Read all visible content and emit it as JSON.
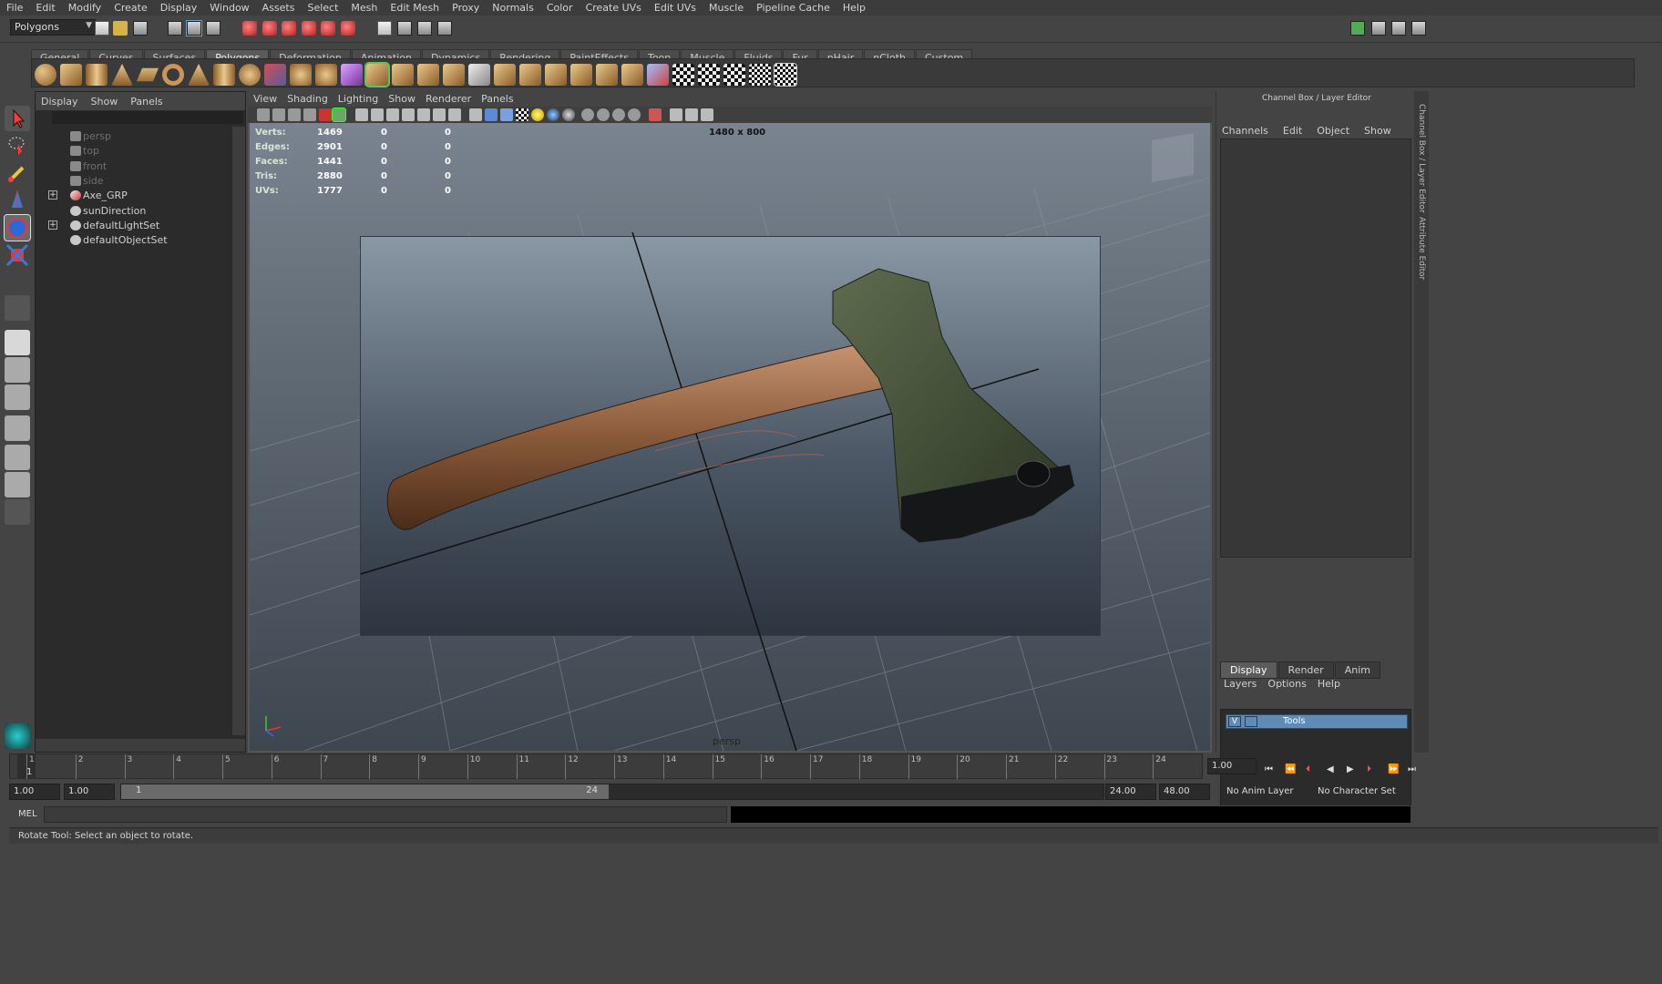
{
  "menubar": [
    "File",
    "Edit",
    "Modify",
    "Create",
    "Display",
    "Window",
    "Assets",
    "Select",
    "Mesh",
    "Edit Mesh",
    "Proxy",
    "Normals",
    "Color",
    "Create UVs",
    "Edit UVs",
    "Muscle",
    "Pipeline Cache",
    "Help"
  ],
  "status": {
    "mode": "Polygons"
  },
  "shelf_tabs": [
    "General",
    "Curves",
    "Surfaces",
    "Polygons",
    "Deformation",
    "Animation",
    "Dynamics",
    "Rendering",
    "PaintEffects",
    "Toon",
    "Muscle",
    "Fluids",
    "Fur",
    "nHair",
    "nCloth",
    "Custom"
  ],
  "shelf_active": "Polygons",
  "outliner": {
    "menu": [
      "Display",
      "Show",
      "Panels"
    ],
    "items": [
      {
        "label": "persp",
        "dim": true
      },
      {
        "label": "top",
        "dim": true
      },
      {
        "label": "front",
        "dim": true
      },
      {
        "label": "side",
        "dim": true
      },
      {
        "label": "Axe_GRP",
        "expand": "+"
      },
      {
        "label": "sunDirection"
      },
      {
        "label": "defaultLightSet",
        "expand": "+"
      },
      {
        "label": "defaultObjectSet"
      }
    ]
  },
  "viewport": {
    "menu": [
      "View",
      "Shading",
      "Lighting",
      "Show",
      "Renderer",
      "Panels"
    ],
    "hud": [
      {
        "label": "Verts:",
        "a": "1469",
        "b": "0",
        "c": "0"
      },
      {
        "label": "Edges:",
        "a": "2901",
        "b": "0",
        "c": "0"
      },
      {
        "label": "Faces:",
        "a": "1441",
        "b": "0",
        "c": "0"
      },
      {
        "label": "Tris:",
        "a": "2880",
        "b": "0",
        "c": "0"
      },
      {
        "label": "UVs:",
        "a": "1777",
        "b": "0",
        "c": "0"
      }
    ],
    "resolution": "1480 x 800",
    "camera": "persp"
  },
  "channel_box": {
    "title": "Channel Box / Layer Editor",
    "menu": [
      "Channels",
      "Edit",
      "Object",
      "Show"
    ],
    "tabs": [
      "Display",
      "Render",
      "Anim"
    ],
    "tab_active": "Display",
    "layer_menu": [
      "Layers",
      "Options",
      "Help"
    ],
    "layer": {
      "v": "V",
      "name": "Tools"
    }
  },
  "side_tabs": [
    "Channel Box / Layer Editor",
    "Attribute Editor"
  ],
  "timeline": {
    "ticks": [
      "1",
      "2",
      "3",
      "4",
      "5",
      "6",
      "7",
      "8",
      "9",
      "10",
      "11",
      "12",
      "13",
      "14",
      "15",
      "16",
      "17",
      "18",
      "19",
      "20",
      "21",
      "22",
      "23",
      "24"
    ],
    "current": "1",
    "current_field": "1.00"
  },
  "range": {
    "start": "1.00",
    "start2": "1.00",
    "inner_start": "1",
    "inner_end": "24",
    "end": "24.00",
    "end2": "48.00",
    "anim_layer": "No Anim Layer",
    "character_set": "No Character Set"
  },
  "cmdline": {
    "label": "MEL"
  },
  "help": "Rotate Tool: Select an object to rotate."
}
